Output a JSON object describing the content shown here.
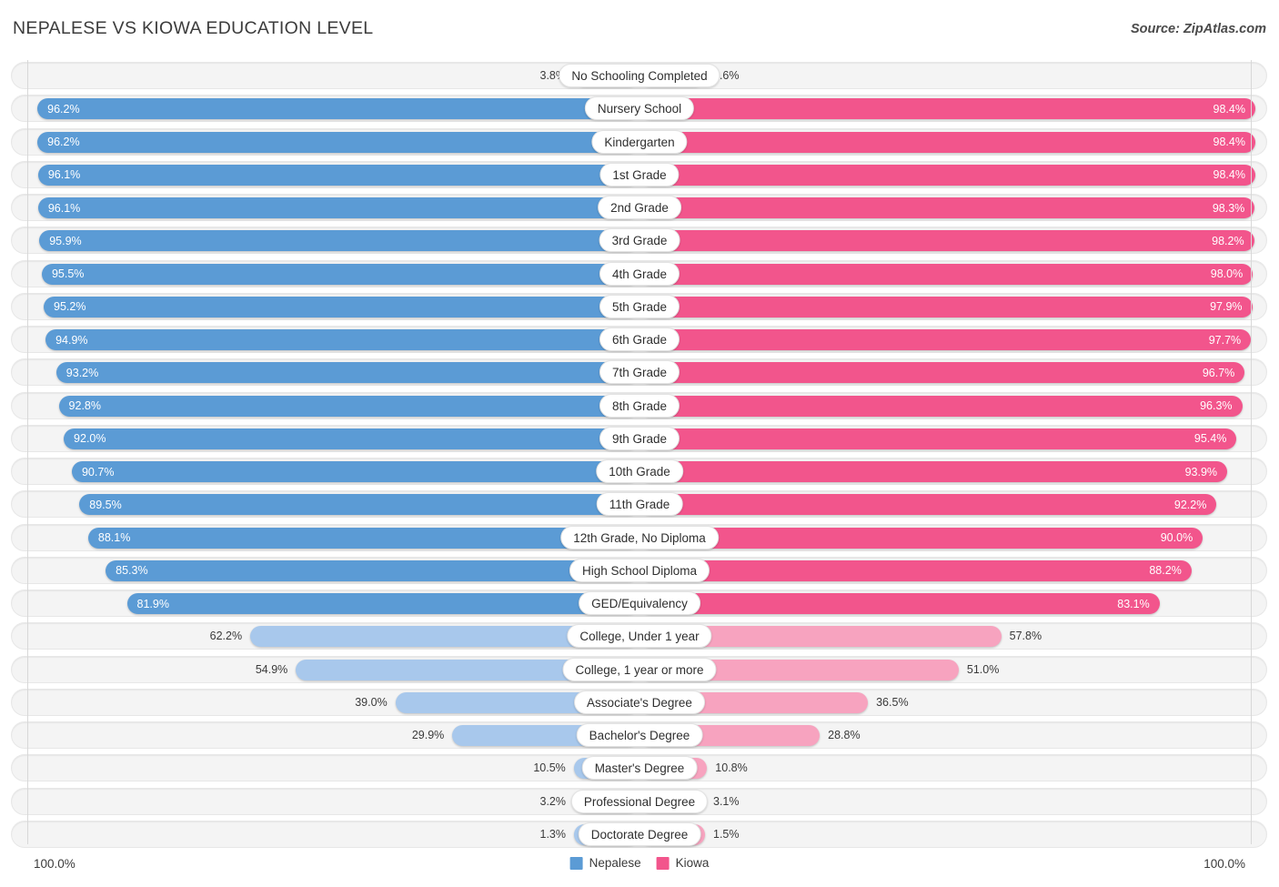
{
  "header": {
    "title": "NEPALESE VS KIOWA EDUCATION LEVEL",
    "source": "Source: ZipAtlas.com"
  },
  "footer": {
    "left_axis_label": "100.0%",
    "right_axis_label": "100.0%"
  },
  "legend": {
    "items": [
      {
        "label": "Nepalese",
        "color": "#5b9bd5"
      },
      {
        "label": "Kiowa",
        "color": "#f2558c"
      }
    ]
  },
  "colors": {
    "nepalese_strong": "#5b9bd5",
    "nepalese_light": "#a8c8ec",
    "kiowa_strong": "#f2558c",
    "kiowa_light": "#f7a3bf",
    "track": "#f4f4f4",
    "grid": "#d8d8d8"
  },
  "chart_data": {
    "type": "bar",
    "title": "NEPALESE VS KIOWA EDUCATION LEVEL",
    "subtitle": "Source: ZipAtlas.com",
    "orientation": "horizontal-diverging",
    "xlabel": "",
    "ylabel": "",
    "xlim": [
      0,
      100
    ],
    "axis_max_label": "100.0%",
    "grid": false,
    "legend_position": "bottom-center",
    "categories": [
      "No Schooling Completed",
      "Nursery School",
      "Kindergarten",
      "1st Grade",
      "2nd Grade",
      "3rd Grade",
      "4th Grade",
      "5th Grade",
      "6th Grade",
      "7th Grade",
      "8th Grade",
      "9th Grade",
      "10th Grade",
      "11th Grade",
      "12th Grade, No Diploma",
      "High School Diploma",
      "GED/Equivalency",
      "College, Under 1 year",
      "College, 1 year or more",
      "Associate's Degree",
      "Bachelor's Degree",
      "Master's Degree",
      "Professional Degree",
      "Doctorate Degree"
    ],
    "series": [
      {
        "name": "Nepalese",
        "color": "#5b9bd5",
        "values": [
          3.8,
          96.2,
          96.2,
          96.1,
          96.1,
          95.9,
          95.5,
          95.2,
          94.9,
          93.2,
          92.8,
          92.0,
          90.7,
          89.5,
          88.1,
          85.3,
          81.9,
          62.2,
          54.9,
          39.0,
          29.9,
          10.5,
          3.2,
          1.3
        ],
        "labels": [
          "3.8%",
          "96.2%",
          "96.2%",
          "96.1%",
          "96.1%",
          "95.9%",
          "95.5%",
          "95.2%",
          "94.9%",
          "93.2%",
          "92.8%",
          "92.0%",
          "90.7%",
          "89.5%",
          "88.1%",
          "85.3%",
          "81.9%",
          "62.2%",
          "54.9%",
          "39.0%",
          "29.9%",
          "10.5%",
          "3.2%",
          "1.3%"
        ]
      },
      {
        "name": "Kiowa",
        "color": "#f2558c",
        "values": [
          1.6,
          98.4,
          98.4,
          98.4,
          98.3,
          98.2,
          98.0,
          97.9,
          97.7,
          96.7,
          96.3,
          95.4,
          93.9,
          92.2,
          90.0,
          88.2,
          83.1,
          57.8,
          51.0,
          36.5,
          28.8,
          10.8,
          3.1,
          1.5
        ],
        "labels": [
          "1.6%",
          "98.4%",
          "98.4%",
          "98.4%",
          "98.3%",
          "98.2%",
          "98.0%",
          "97.9%",
          "97.7%",
          "96.7%",
          "96.3%",
          "95.4%",
          "93.9%",
          "92.2%",
          "90.0%",
          "88.2%",
          "83.1%",
          "57.8%",
          "51.0%",
          "36.5%",
          "28.8%",
          "10.8%",
          "3.1%",
          "1.5%"
        ]
      }
    ]
  }
}
